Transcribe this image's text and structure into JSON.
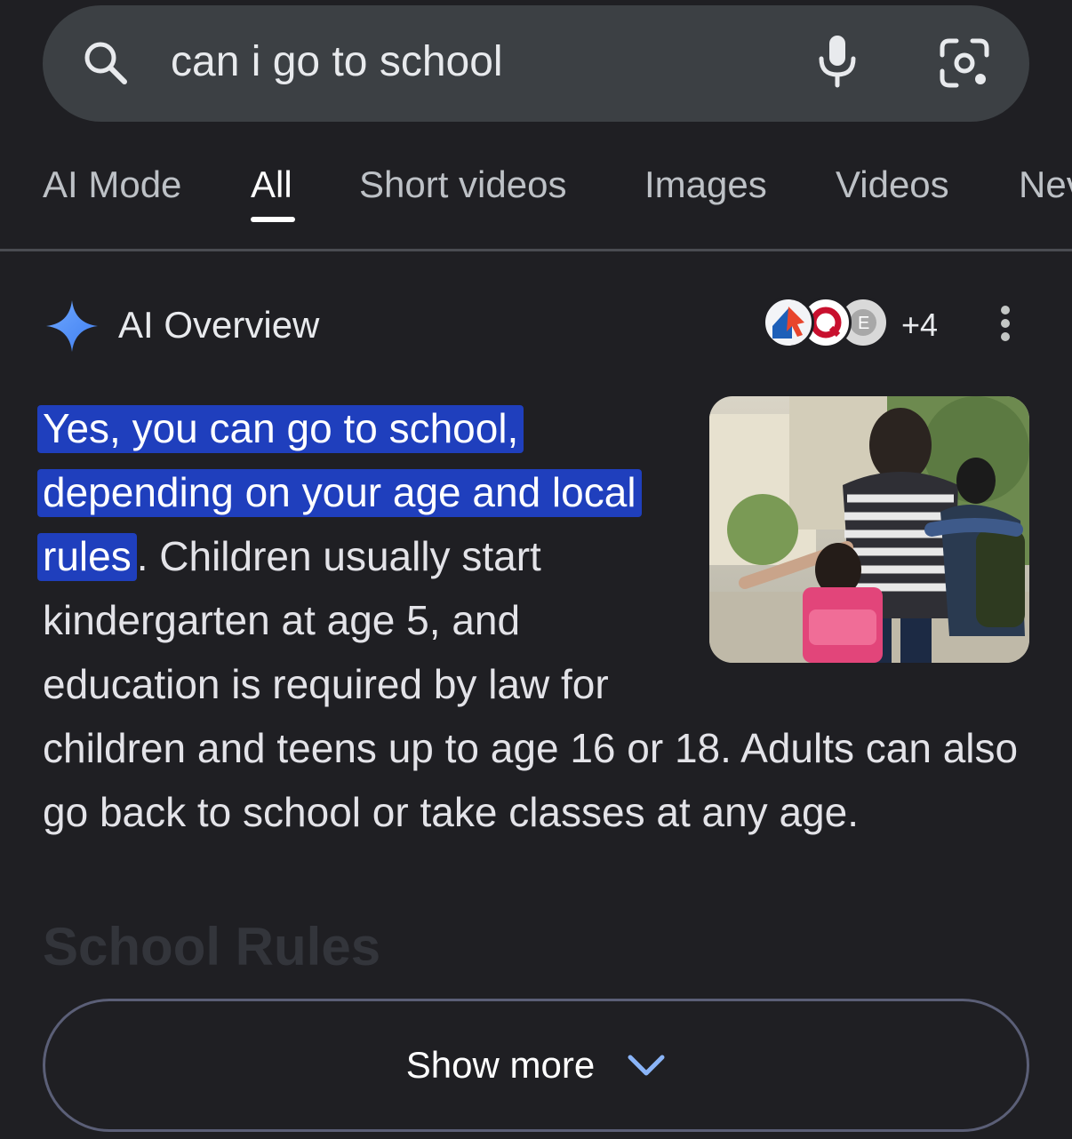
{
  "search": {
    "query": "can i go to school"
  },
  "tabs": [
    {
      "label": "AI Mode",
      "active": false
    },
    {
      "label": "All",
      "active": true
    },
    {
      "label": "Short videos",
      "active": false
    },
    {
      "label": "Images",
      "active": false
    },
    {
      "label": "Videos",
      "active": false
    },
    {
      "label": "Nev",
      "active": false
    }
  ],
  "ai_overview": {
    "title": "AI Overview",
    "sources_extra": "+4",
    "highlighted_text": "Yes, you can go to school, depending on your age and local rules",
    "body_text": ". Children usually start kindergarten at age 5, and education is required by law for children and teens up to age 16 or 18. Adults can also go back to school or take classes at any age.",
    "next_heading": "School Rules",
    "show_more": "Show more"
  },
  "colors": {
    "background": "#1f1f23",
    "search_bar": "#3c4044",
    "highlight": "#1f3fbd",
    "spark_blue": "#4c8df6",
    "button_border": "#5b5f77",
    "chevron": "#8ab4f8"
  },
  "icons": [
    "search-icon",
    "mic-icon",
    "lens-icon",
    "sparkle-icon",
    "more-vert-icon",
    "chevron-down-icon"
  ]
}
